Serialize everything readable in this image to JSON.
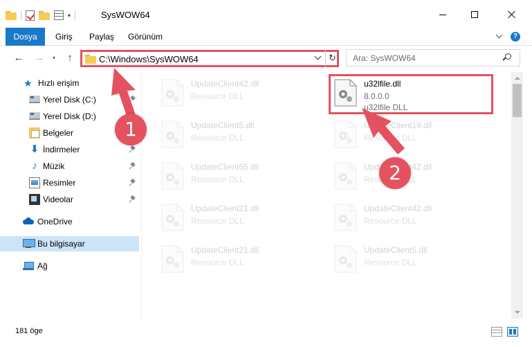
{
  "window": {
    "title": "SysWOW64",
    "qat_drop": "▾"
  },
  "ribbon": {
    "tabs": [
      "Dosya",
      "Giriş",
      "Paylaş",
      "Görünüm"
    ],
    "help": "?"
  },
  "nav": {
    "back": "←",
    "forward": "→",
    "recent": "▾",
    "up": "↑",
    "refresh": "↻"
  },
  "address": {
    "path": "C:\\Windows\\SysWOW64"
  },
  "search": {
    "placeholder": "Ara: SysWOW64"
  },
  "sidebar": {
    "items": [
      {
        "label": "Hızlı erişim",
        "icon": "star-icon"
      },
      {
        "label": "Yerel Disk (C:)",
        "icon": "disk-icon"
      },
      {
        "label": "Yerel Disk (D:)",
        "icon": "disk-icon"
      },
      {
        "label": "Belgeler",
        "icon": "documents-icon"
      },
      {
        "label": "İndirmeler",
        "icon": "downloads-icon"
      },
      {
        "label": "Müzik",
        "icon": "music-icon"
      },
      {
        "label": "Resimler",
        "icon": "pictures-icon"
      },
      {
        "label": "Videolar",
        "icon": "videos-icon"
      },
      {
        "label": "OneDrive",
        "icon": "onedrive-icon"
      },
      {
        "label": "Bu bilgisayar",
        "icon": "this-pc-icon"
      },
      {
        "label": "Ağ",
        "icon": "network-icon"
      }
    ],
    "star_glyph": "★",
    "down_glyph": "⬇",
    "music_glyph": "♪"
  },
  "files": {
    "target": {
      "name": "u32lfile.dll",
      "version": "8.0.0.0",
      "description": "u32lfile DLL"
    },
    "left_column": [
      {
        "name": "UpdateClient42.dll",
        "type": "Resource DLL"
      },
      {
        "name": "UpdateClient5.dll",
        "type": "Resource DLL"
      },
      {
        "name": "UpdateClient65.dll",
        "type": "Resource DLL"
      },
      {
        "name": "UpdateClient21.dll",
        "type": "Resource DLL"
      },
      {
        "name": "UpdateClient21.dll",
        "type": "Resource DLL"
      }
    ],
    "right_column": [
      {
        "name": "UpdateClient19.dll",
        "type": "Resource DLL"
      },
      {
        "name": "UpdateClient42.dll",
        "type": "Resource DLL"
      },
      {
        "name": "UpdateClient42.dll",
        "type": "Resource DLL"
      },
      {
        "name": "UpdateClient5.dll",
        "type": "Resource DLL"
      }
    ]
  },
  "status": {
    "item_count": "181 öge"
  },
  "annotations": {
    "step1": "1",
    "step2": "2",
    "color": "#e4525f"
  },
  "colors": {
    "accent": "#1979ca",
    "selection": "#cce4f7"
  }
}
